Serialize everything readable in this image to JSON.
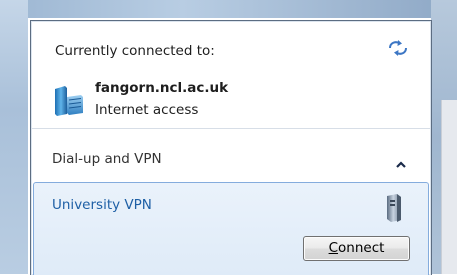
{
  "flyout": {
    "connected_label": "Currently connected to:",
    "network": {
      "name": "fangorn.ncl.ac.uk",
      "status": "Internet access",
      "icon": "network-icon"
    },
    "refresh_icon": "refresh-icon",
    "dialup": {
      "label": "Dial-up and VPN",
      "toggle_icon": "chevron-up-icon",
      "items": [
        {
          "name": "University VPN",
          "icon": "vpn-icon",
          "button": {
            "mnemonic": "C",
            "label_rest": "onnect"
          }
        }
      ]
    }
  },
  "colors": {
    "vpn_link": "#1e5fa5",
    "selected_bg": "#dfebf8",
    "selected_border": "#84acdd"
  }
}
